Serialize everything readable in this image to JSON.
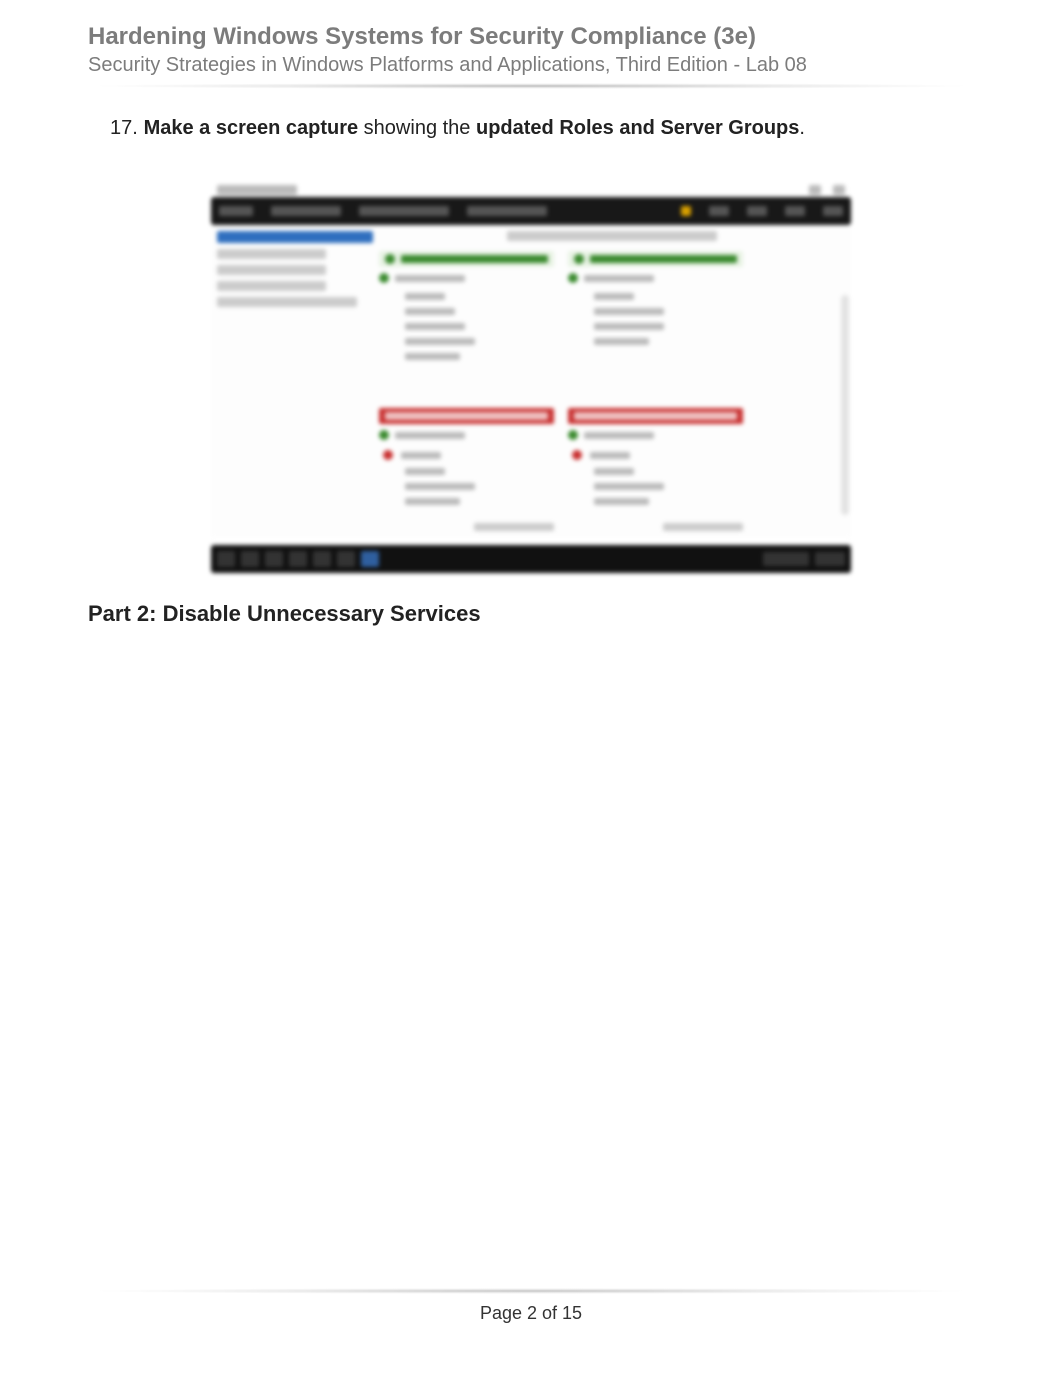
{
  "header": {
    "title": "Hardening Windows Systems for Security Compliance (3e)",
    "subtitle": "Security Strategies in Windows Platforms and Applications, Third Edition - Lab 08"
  },
  "instruction": {
    "number": "17.",
    "part1_bold": "Make a screen capture",
    "part2_plain": " showing the ",
    "part3_bold": "updated Roles and Server Groups",
    "part4_plain": "."
  },
  "section_heading": "Part 2: Disable Unnecessary Services",
  "page_label": "Page 2 of 15"
}
